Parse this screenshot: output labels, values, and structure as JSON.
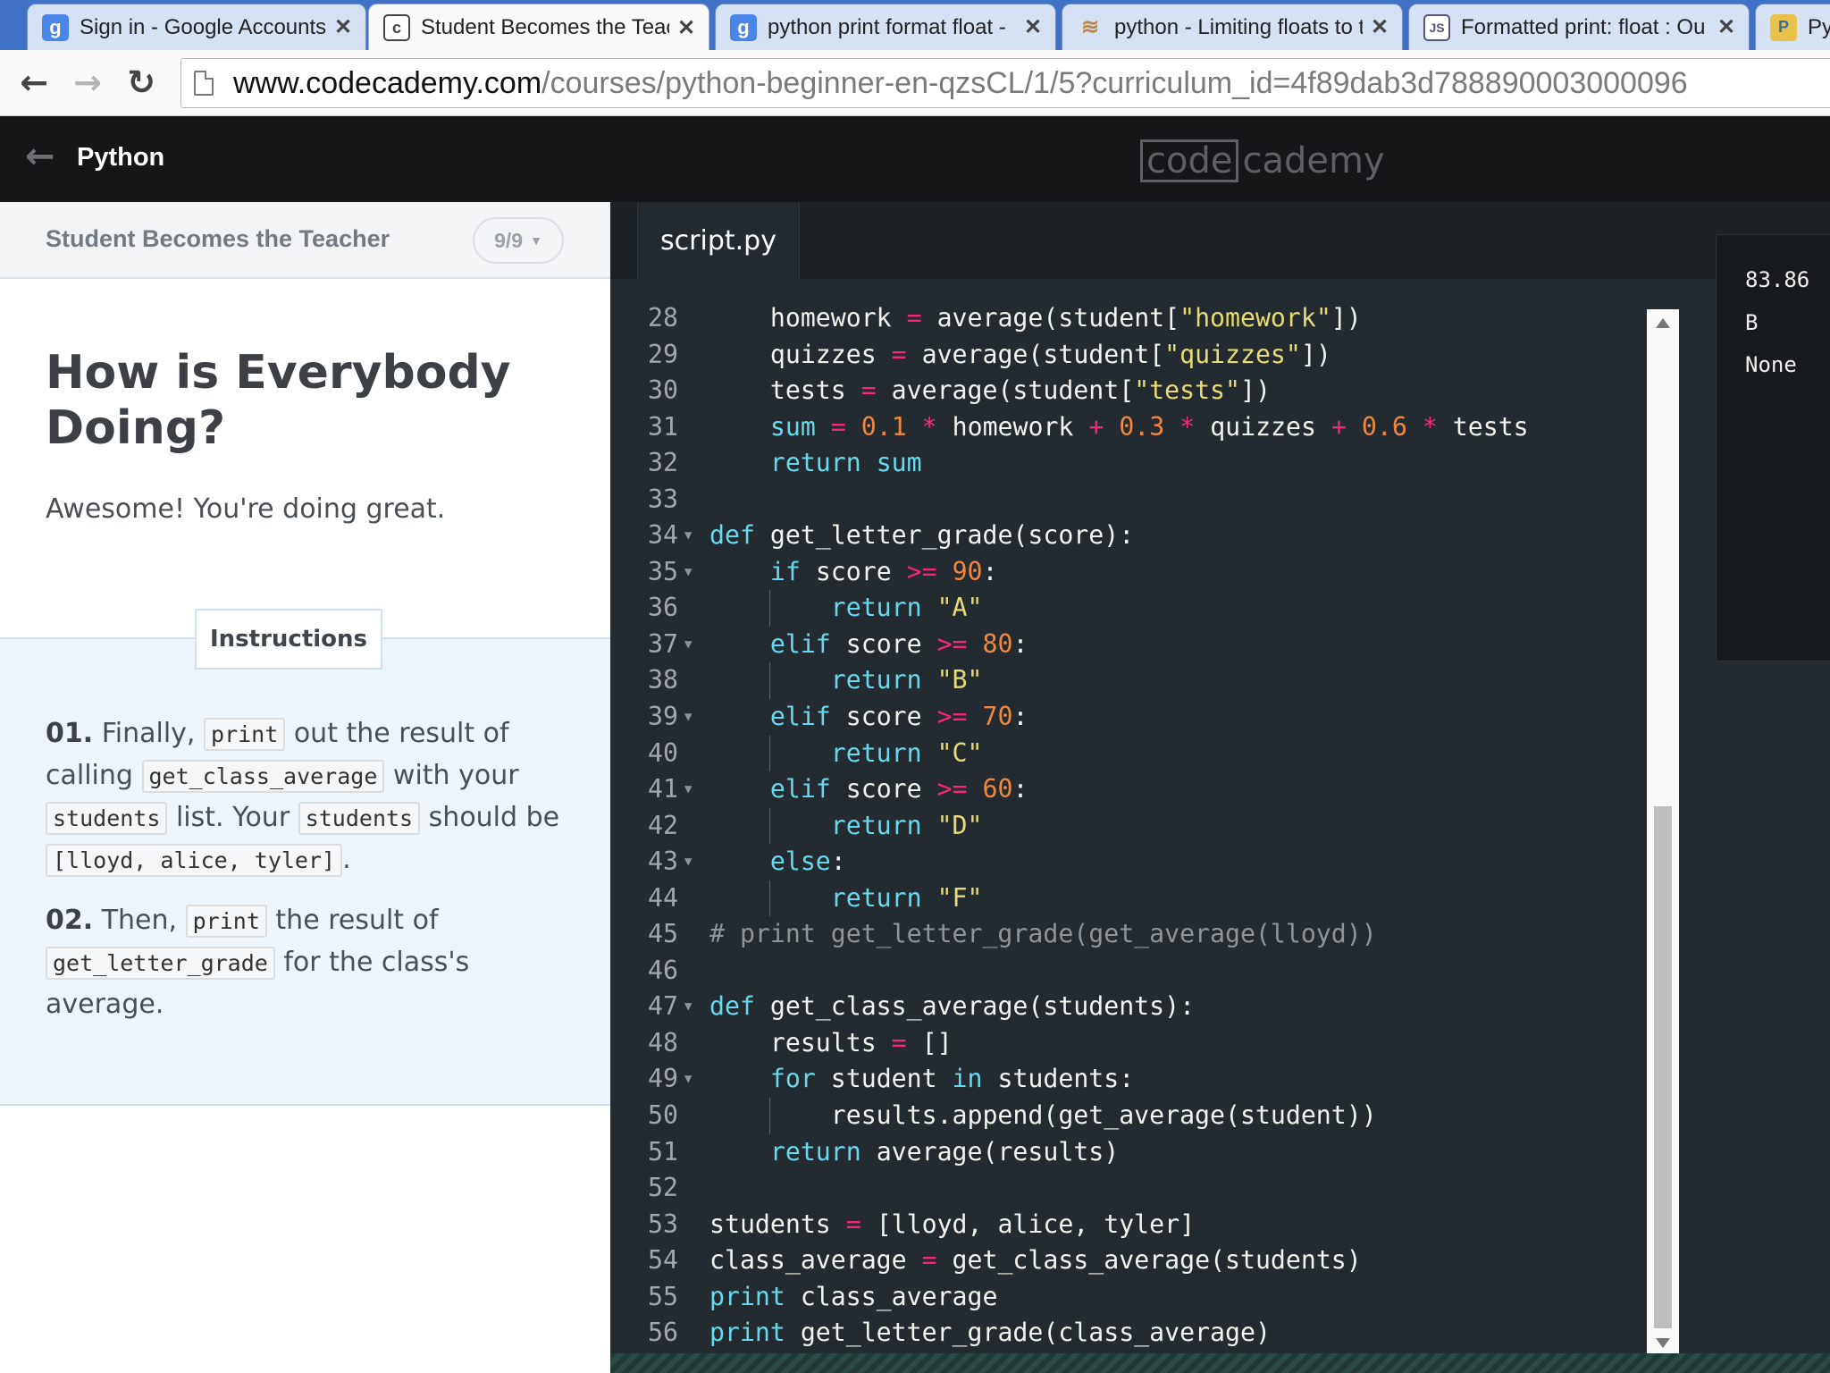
{
  "browser": {
    "tabs": [
      {
        "title": "Sign in - Google Accounts",
        "icon": "google-icon",
        "active": false
      },
      {
        "title": "Student Becomes the Teac",
        "icon": "codecademy-icon",
        "active": true
      },
      {
        "title": "python print format float -",
        "icon": "google-icon",
        "active": false
      },
      {
        "title": "python - Limiting floats to t",
        "icon": "stackoverflow-icon",
        "active": false
      },
      {
        "title": "Formatted print: float : Ou",
        "icon": "java2s-icon",
        "active": false
      },
      {
        "title": "Py",
        "icon": "python-icon",
        "active": false
      }
    ],
    "url_host": "www.codecademy.com",
    "url_path": "/courses/python-beginner-en-qzsCL/1/5?curriculum_id=4f89dab3d788890003000096"
  },
  "header": {
    "course": "Python",
    "logo_left": "code",
    "logo_right": "cademy"
  },
  "lesson": {
    "name": "Student Becomes the Teacher",
    "progress": "9/9",
    "title": "How is Everybody Doing?",
    "subtitle": "Awesome! You're doing great.",
    "instructions_label": "Instructions",
    "step1": {
      "num": "01.",
      "t1": "Finally,",
      "c1": "print",
      "t2": "out the result of calling",
      "c2": "get_class_average",
      "t3": "with your",
      "c3": "students",
      "t4": "list. Your",
      "c4": "students",
      "t5": "should be",
      "c5": "[lloyd, alice, tyler]",
      "t6": "."
    },
    "step2": {
      "num": "02.",
      "t1": "Then,",
      "c1": "print",
      "t2": "the result of",
      "c2": "get_letter_grade",
      "t3": "for the class's average."
    }
  },
  "editor": {
    "filename": "script.py",
    "lines": [
      {
        "n": "28",
        "fold": false,
        "guide": false,
        "tokens": [
          [
            "    homework ",
            ""
          ],
          [
            "=",
            "op"
          ],
          [
            " average(student[",
            ""
          ],
          [
            "\"homework\"",
            "str"
          ],
          [
            "])",
            ""
          ]
        ]
      },
      {
        "n": "29",
        "fold": false,
        "guide": false,
        "tokens": [
          [
            "    quizzes ",
            ""
          ],
          [
            "=",
            "op"
          ],
          [
            " average(student[",
            ""
          ],
          [
            "\"quizzes\"",
            "str"
          ],
          [
            "])",
            ""
          ]
        ]
      },
      {
        "n": "30",
        "fold": false,
        "guide": false,
        "tokens": [
          [
            "    tests ",
            ""
          ],
          [
            "=",
            "op"
          ],
          [
            " average(student[",
            ""
          ],
          [
            "\"tests\"",
            "str"
          ],
          [
            "])",
            ""
          ]
        ]
      },
      {
        "n": "31",
        "fold": false,
        "guide": false,
        "tokens": [
          [
            "    ",
            ""
          ],
          [
            "sum",
            "kw"
          ],
          [
            " ",
            ""
          ],
          [
            "=",
            "op"
          ],
          [
            " ",
            ""
          ],
          [
            "0.1",
            "num"
          ],
          [
            " ",
            ""
          ],
          [
            "*",
            "op"
          ],
          [
            " homework ",
            ""
          ],
          [
            "+",
            "op"
          ],
          [
            " ",
            ""
          ],
          [
            "0.3",
            "num"
          ],
          [
            " ",
            ""
          ],
          [
            "*",
            "op"
          ],
          [
            " quizzes ",
            ""
          ],
          [
            "+",
            "op"
          ],
          [
            " ",
            ""
          ],
          [
            "0.6",
            "num"
          ],
          [
            " ",
            ""
          ],
          [
            "*",
            "op"
          ],
          [
            " tests",
            ""
          ]
        ]
      },
      {
        "n": "32",
        "fold": false,
        "guide": false,
        "tokens": [
          [
            "    ",
            ""
          ],
          [
            "return",
            "kw"
          ],
          [
            " ",
            ""
          ],
          [
            "sum",
            "kw"
          ]
        ]
      },
      {
        "n": "33",
        "fold": false,
        "guide": false,
        "tokens": []
      },
      {
        "n": "34",
        "fold": true,
        "guide": false,
        "tokens": [
          [
            "def",
            "kw"
          ],
          [
            " get_letter_grade(score):",
            ""
          ]
        ]
      },
      {
        "n": "35",
        "fold": true,
        "guide": false,
        "tokens": [
          [
            "    ",
            ""
          ],
          [
            "if",
            "kw"
          ],
          [
            " score ",
            ""
          ],
          [
            ">=",
            "op"
          ],
          [
            " ",
            ""
          ],
          [
            "90",
            "num"
          ],
          [
            ":",
            ""
          ]
        ]
      },
      {
        "n": "36",
        "fold": false,
        "guide": true,
        "tokens": [
          [
            "        ",
            ""
          ],
          [
            "return",
            "kw"
          ],
          [
            " ",
            ""
          ],
          [
            "\"A\"",
            "str"
          ]
        ]
      },
      {
        "n": "37",
        "fold": true,
        "guide": false,
        "tokens": [
          [
            "    ",
            ""
          ],
          [
            "elif",
            "kw"
          ],
          [
            " score ",
            ""
          ],
          [
            ">=",
            "op"
          ],
          [
            " ",
            ""
          ],
          [
            "80",
            "num"
          ],
          [
            ":",
            ""
          ]
        ]
      },
      {
        "n": "38",
        "fold": false,
        "guide": true,
        "tokens": [
          [
            "        ",
            ""
          ],
          [
            "return",
            "kw"
          ],
          [
            " ",
            ""
          ],
          [
            "\"B\"",
            "str"
          ]
        ]
      },
      {
        "n": "39",
        "fold": true,
        "guide": false,
        "tokens": [
          [
            "    ",
            ""
          ],
          [
            "elif",
            "kw"
          ],
          [
            " score ",
            ""
          ],
          [
            ">=",
            "op"
          ],
          [
            " ",
            ""
          ],
          [
            "70",
            "num"
          ],
          [
            ":",
            ""
          ]
        ]
      },
      {
        "n": "40",
        "fold": false,
        "guide": true,
        "tokens": [
          [
            "        ",
            ""
          ],
          [
            "return",
            "kw"
          ],
          [
            " ",
            ""
          ],
          [
            "\"C\"",
            "str"
          ]
        ]
      },
      {
        "n": "41",
        "fold": true,
        "guide": false,
        "tokens": [
          [
            "    ",
            ""
          ],
          [
            "elif",
            "kw"
          ],
          [
            " score ",
            ""
          ],
          [
            ">=",
            "op"
          ],
          [
            " ",
            ""
          ],
          [
            "60",
            "num"
          ],
          [
            ":",
            ""
          ]
        ]
      },
      {
        "n": "42",
        "fold": false,
        "guide": true,
        "tokens": [
          [
            "        ",
            ""
          ],
          [
            "return",
            "kw"
          ],
          [
            " ",
            ""
          ],
          [
            "\"D\"",
            "str"
          ]
        ]
      },
      {
        "n": "43",
        "fold": true,
        "guide": false,
        "tokens": [
          [
            "    ",
            ""
          ],
          [
            "else",
            "kw"
          ],
          [
            ":",
            ""
          ]
        ]
      },
      {
        "n": "44",
        "fold": false,
        "guide": true,
        "tokens": [
          [
            "        ",
            ""
          ],
          [
            "return",
            "kw"
          ],
          [
            " ",
            ""
          ],
          [
            "\"F\"",
            "str"
          ]
        ]
      },
      {
        "n": "45",
        "fold": false,
        "guide": false,
        "tokens": [
          [
            "# print get_letter_grade(get_average(lloyd))",
            "cm"
          ]
        ]
      },
      {
        "n": "46",
        "fold": false,
        "guide": false,
        "tokens": []
      },
      {
        "n": "47",
        "fold": true,
        "guide": false,
        "tokens": [
          [
            "def",
            "kw"
          ],
          [
            " get_class_average(students):",
            ""
          ]
        ]
      },
      {
        "n": "48",
        "fold": false,
        "guide": false,
        "tokens": [
          [
            "    results ",
            ""
          ],
          [
            "=",
            "op"
          ],
          [
            " []",
            ""
          ]
        ]
      },
      {
        "n": "49",
        "fold": true,
        "guide": false,
        "tokens": [
          [
            "    ",
            ""
          ],
          [
            "for",
            "kw"
          ],
          [
            " student ",
            ""
          ],
          [
            "in",
            "kw"
          ],
          [
            " students:",
            ""
          ]
        ]
      },
      {
        "n": "50",
        "fold": false,
        "guide": true,
        "tokens": [
          [
            "        results.append(get_average(student))",
            ""
          ]
        ]
      },
      {
        "n": "51",
        "fold": false,
        "guide": false,
        "tokens": [
          [
            "    ",
            ""
          ],
          [
            "return",
            "kw"
          ],
          [
            " average(results)",
            ""
          ]
        ]
      },
      {
        "n": "52",
        "fold": false,
        "guide": false,
        "tokens": []
      },
      {
        "n": "53",
        "fold": false,
        "guide": false,
        "tokens": [
          [
            "students ",
            ""
          ],
          [
            "=",
            "op"
          ],
          [
            " [lloyd, alice, tyler]",
            ""
          ]
        ]
      },
      {
        "n": "54",
        "fold": false,
        "guide": false,
        "tokens": [
          [
            "class_average ",
            ""
          ],
          [
            "=",
            "op"
          ],
          [
            " get_class_average(students)",
            ""
          ]
        ]
      },
      {
        "n": "55",
        "fold": false,
        "guide": false,
        "tokens": [
          [
            "print",
            "kw"
          ],
          [
            " class_average",
            ""
          ]
        ]
      },
      {
        "n": "56",
        "fold": false,
        "guide": false,
        "tokens": [
          [
            "print",
            "kw"
          ],
          [
            " get_letter_grade(class_average)",
            ""
          ]
        ]
      }
    ]
  },
  "console": {
    "lines": [
      "83.86",
      "B",
      "None"
    ]
  }
}
